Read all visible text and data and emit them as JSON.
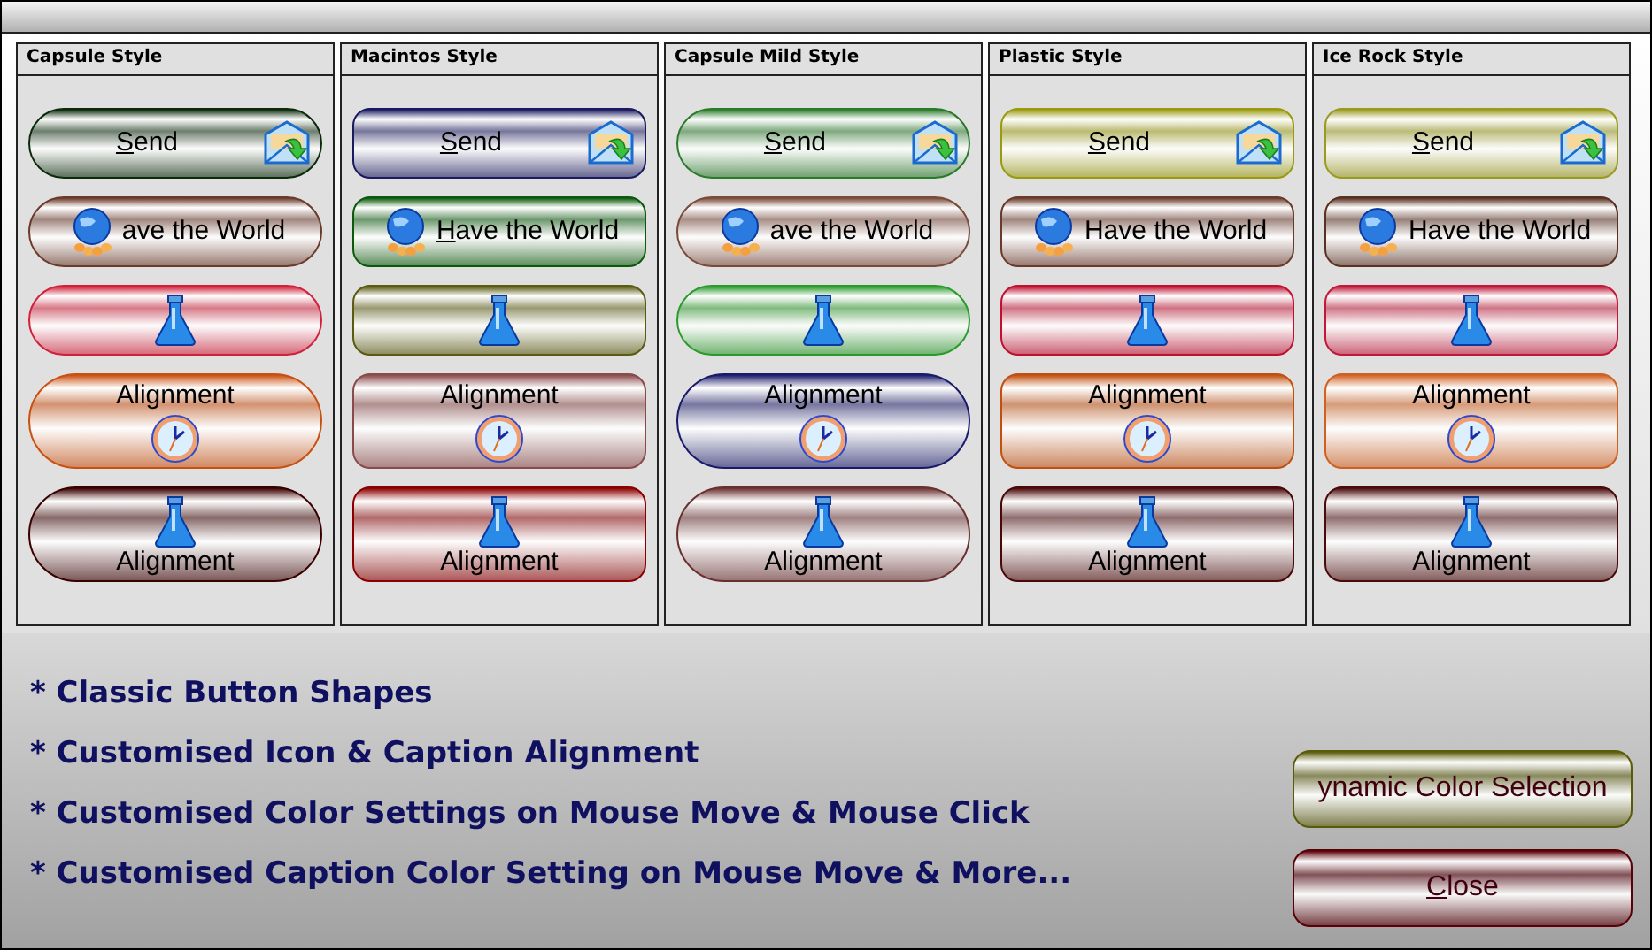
{
  "panels": [
    {
      "title": "Capsule Style",
      "kind": "capsule",
      "buttons": [
        {
          "kind": "send",
          "label": "Send",
          "underline_first": true,
          "color": "#0a2a0a"
        },
        {
          "kind": "world",
          "label": "ave the World",
          "underline_first": false,
          "color": "#6b3a2a"
        },
        {
          "kind": "flask",
          "color": "#d0203a"
        },
        {
          "kind": "clock-below",
          "label": "Alignment",
          "underline_first": false,
          "color": "#c85010"
        },
        {
          "kind": "flask-above",
          "label": "Alignment",
          "underline_first": false,
          "color": "#3a0000"
        }
      ]
    },
    {
      "title": "Macintos Style",
      "kind": "rounded",
      "buttons": [
        {
          "kind": "send",
          "label": "Send",
          "underline_first": true,
          "color": "#1a1a60"
        },
        {
          "kind": "world",
          "label": "Have the World",
          "underline_first": true,
          "color": "#0a5a0a"
        },
        {
          "kind": "flask",
          "color": "#5a5a10"
        },
        {
          "kind": "clock-below",
          "label": "Alignment",
          "underline_first": false,
          "color": "#8a4a4a"
        },
        {
          "kind": "flask-above",
          "label": "Alignment",
          "underline_first": false,
          "color": "#8a0000"
        }
      ]
    },
    {
      "title": "Capsule Mild Style",
      "kind": "capsule",
      "buttons": [
        {
          "kind": "send",
          "label": "Send",
          "underline_first": true,
          "color": "#2a7a2a"
        },
        {
          "kind": "world",
          "label": "ave the World",
          "underline_first": false,
          "color": "#7a4a3a"
        },
        {
          "kind": "flask",
          "color": "#2a9a2a"
        },
        {
          "kind": "clock-below",
          "label": "Alignment",
          "underline_first": false,
          "color": "#1a1a6a"
        },
        {
          "kind": "flask-above",
          "label": "Alignment",
          "underline_first": false,
          "color": "#6a3030"
        }
      ]
    },
    {
      "title": "Plastic Style",
      "kind": "rounded",
      "buttons": [
        {
          "kind": "send",
          "label": "Send",
          "underline_first": true,
          "color": "#9a9a10"
        },
        {
          "kind": "world",
          "label": "Have the World",
          "underline_first": false,
          "color": "#6a3a2a"
        },
        {
          "kind": "flask",
          "color": "#c01030"
        },
        {
          "kind": "clock-below",
          "label": "Alignment",
          "underline_first": false,
          "color": "#c05010"
        },
        {
          "kind": "flask-above",
          "label": "Alignment",
          "underline_first": false,
          "color": "#4a0808"
        }
      ]
    },
    {
      "title": "Ice Rock Style",
      "kind": "rounded",
      "buttons": [
        {
          "kind": "send",
          "label": "Send",
          "underline_first": true,
          "color": "#9a9a20"
        },
        {
          "kind": "world",
          "label": "Have the World",
          "underline_first": false,
          "color": "#5a3020"
        },
        {
          "kind": "flask",
          "color": "#c01838"
        },
        {
          "kind": "clock-below",
          "label": "Alignment",
          "underline_first": false,
          "color": "#d06020"
        },
        {
          "kind": "flask-above",
          "label": "Alignment",
          "underline_first": false,
          "color": "#4a0a0a"
        }
      ]
    }
  ],
  "features": [
    "* Classic Button Shapes",
    "* Customised Icon & Caption Alignment",
    "* Customised Color Settings on Mouse Move & Mouse Click",
    "* Customised Caption Color Setting on Mouse Move & More..."
  ],
  "actions": [
    {
      "label": "ynamic Color Selection",
      "underline_first": false,
      "color": "#5a5a08"
    },
    {
      "label": "Close",
      "underline_first": true,
      "color": "#5a0008"
    }
  ]
}
